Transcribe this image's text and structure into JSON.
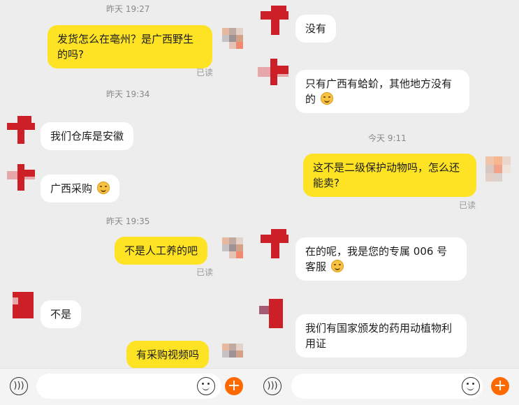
{
  "colors": {
    "accent": "#ff6a00",
    "outgoing_bubble": "#fde324",
    "incoming_bubble": "#ffffff",
    "background": "#ededed"
  },
  "left": {
    "messages": [
      {
        "kind": "time",
        "text": "昨天 19:27"
      },
      {
        "kind": "out",
        "text": "发货怎么在亳州？是广西野生的吗?",
        "status": "已读"
      },
      {
        "kind": "time",
        "text": "昨天 19:34"
      },
      {
        "kind": "in",
        "text": "我们仓库是安徽"
      },
      {
        "kind": "in",
        "text": "广西采购",
        "emoji": "smile-emoji"
      },
      {
        "kind": "time",
        "text": "昨天 19:35"
      },
      {
        "kind": "out",
        "text": "不是人工养的吧",
        "status": "已读"
      },
      {
        "kind": "in",
        "text": "不是"
      },
      {
        "kind": "out",
        "text": "有采购视频吗"
      }
    ],
    "footer": {
      "voice_icon": "voice-icon",
      "emoji_icon": "emoji-icon",
      "plus_icon": "plus-icon",
      "plus_glyph": "+"
    }
  },
  "right": {
    "messages": [
      {
        "kind": "in",
        "text": "没有"
      },
      {
        "kind": "in",
        "text": "只有广西有蛤蚧，其他地方没有的",
        "emoji": "smile-emoji"
      },
      {
        "kind": "time",
        "text": "今天 9:11"
      },
      {
        "kind": "out",
        "text": "这不是二级保护动物吗，怎么还能卖?",
        "status": "已读"
      },
      {
        "kind": "in",
        "text": "在的呢，我是您的专属 006 号客服",
        "emoji": "blush-emoji"
      },
      {
        "kind": "in",
        "text": "我们有国家颁发的药用动植物利用证"
      }
    ],
    "footer": {
      "voice_icon": "voice-icon",
      "emoji_icon": "emoji-icon",
      "plus_icon": "plus-icon",
      "plus_glyph": "+"
    }
  }
}
